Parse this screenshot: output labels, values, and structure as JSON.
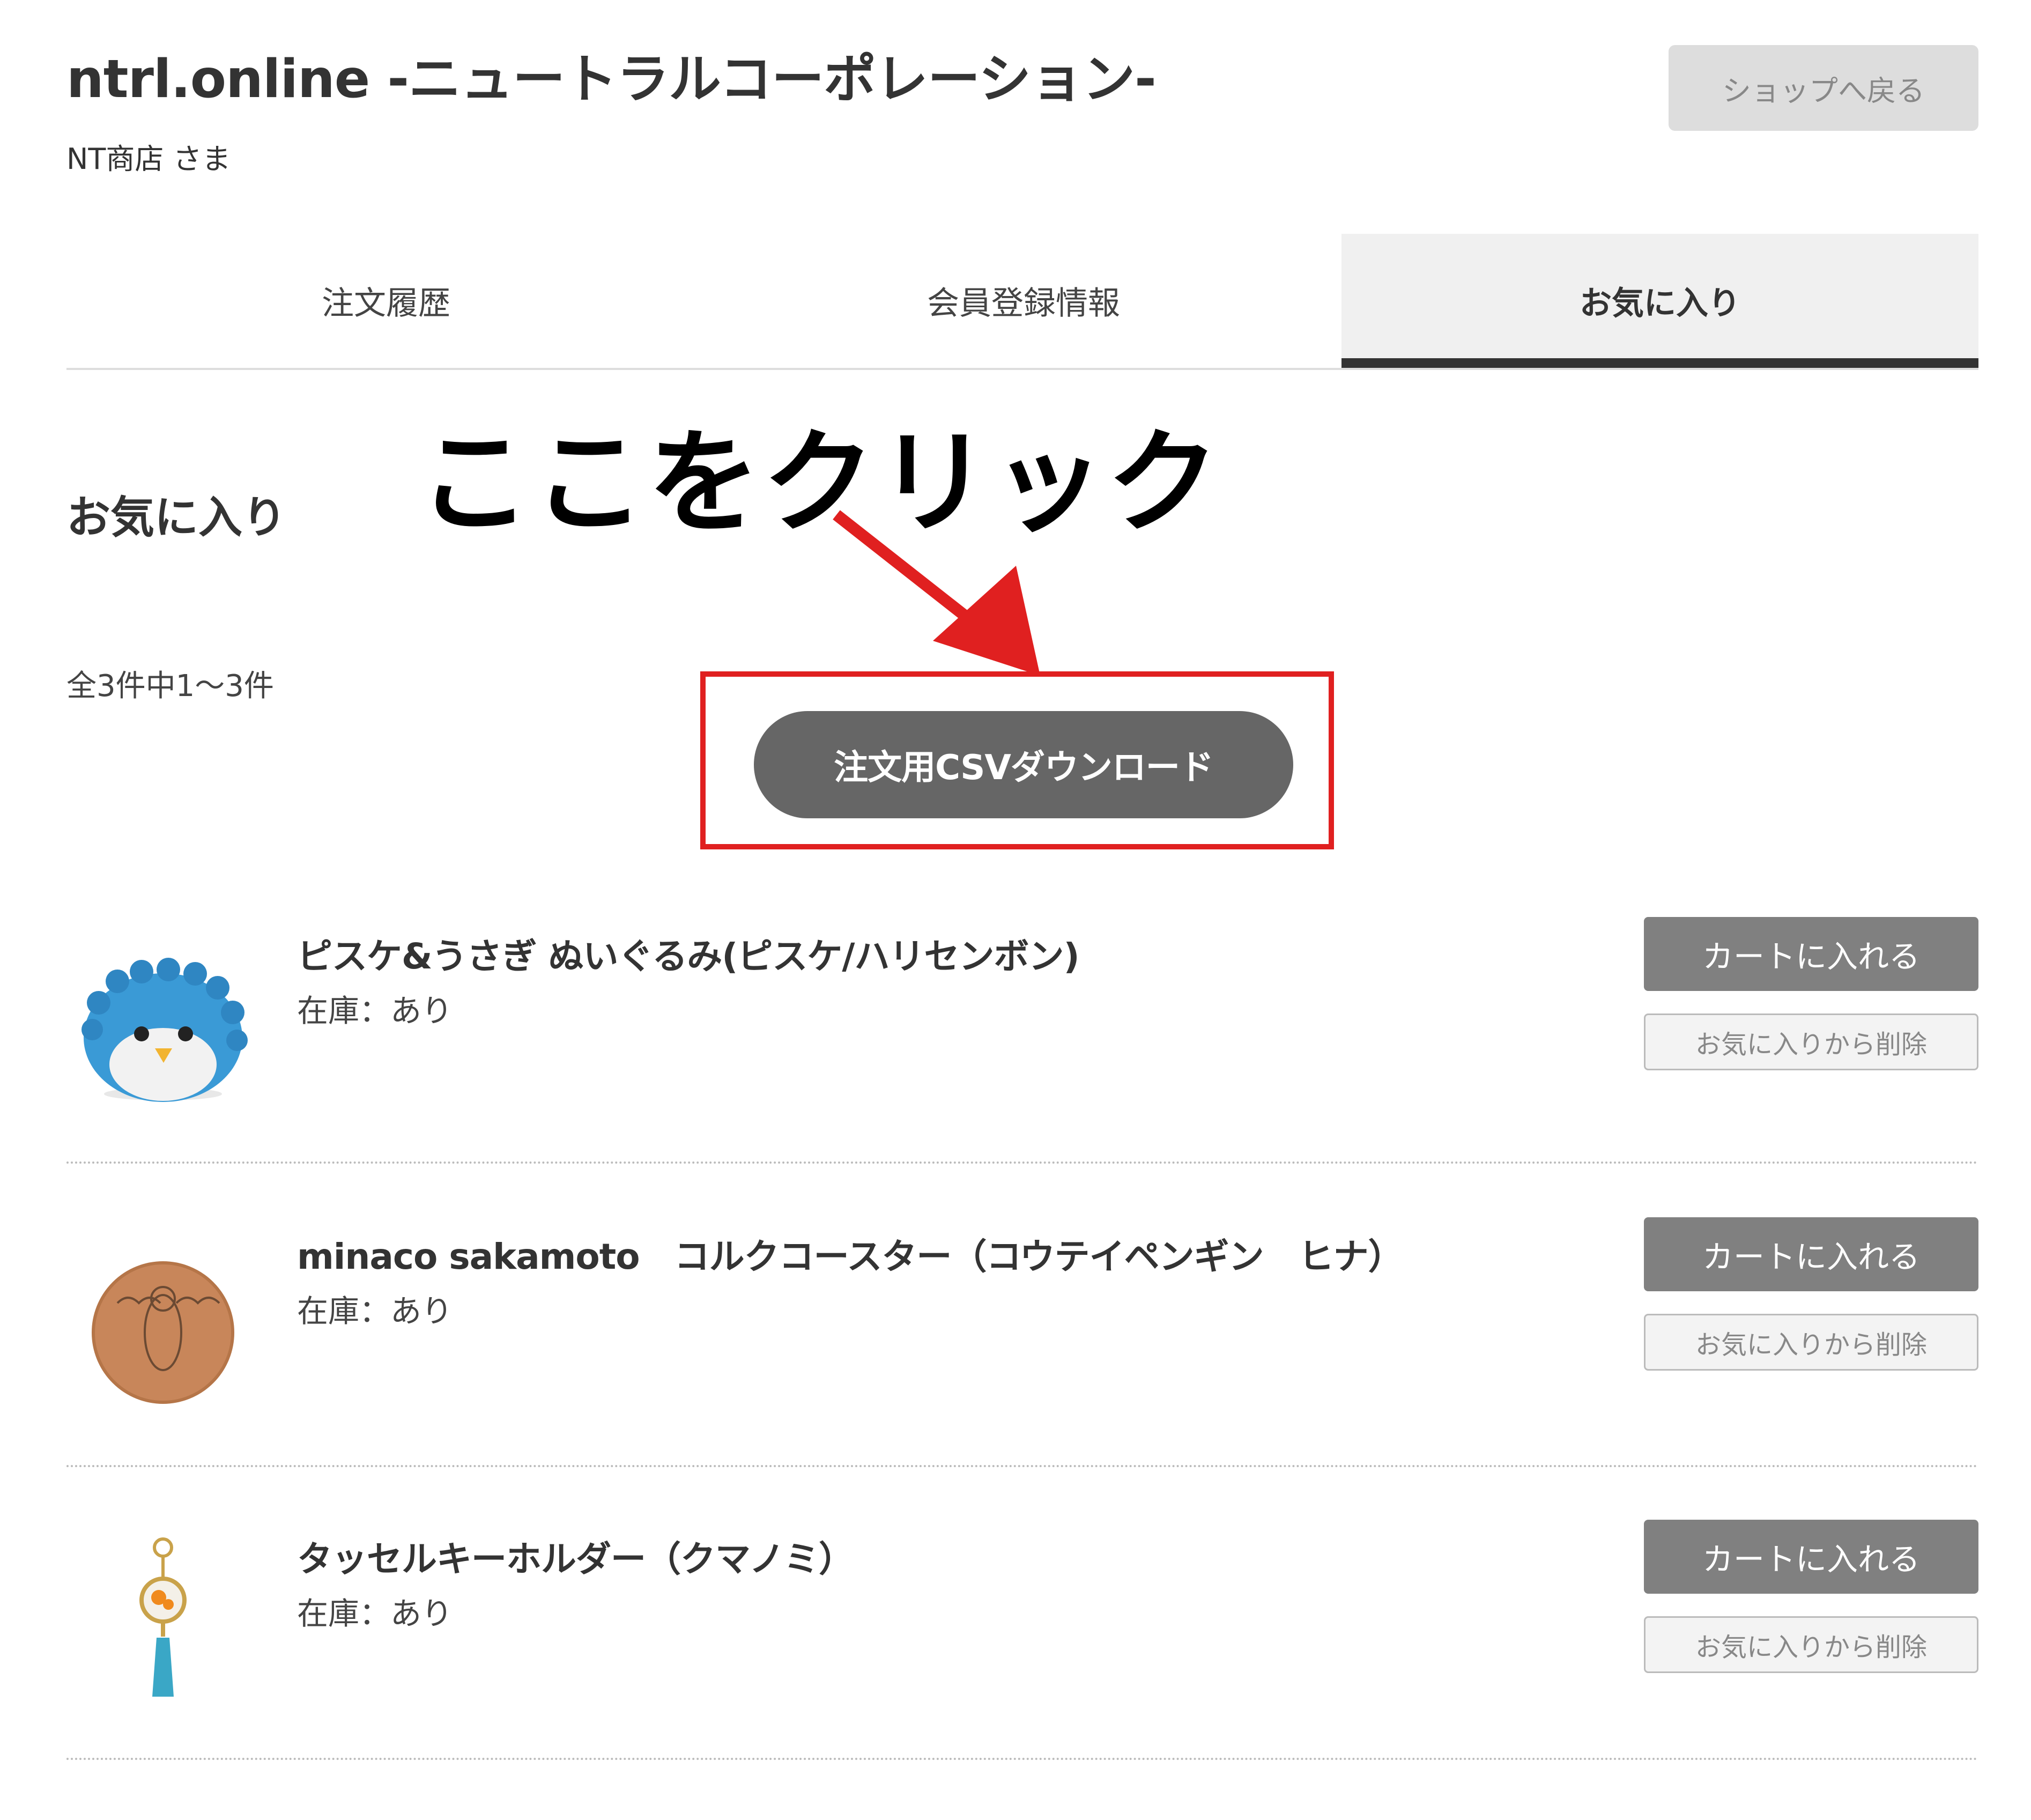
{
  "header": {
    "site_title": "ntrl.online -ニュートラルコーポレーション-",
    "account_name": "NT商店 さま",
    "back_button_label": "ショップへ戻る"
  },
  "tabs": [
    {
      "label": "注文履歴",
      "active": false
    },
    {
      "label": "会員登録情報",
      "active": false
    },
    {
      "label": "お気に入り",
      "active": true
    }
  ],
  "annotation": {
    "callout_text": "ここをクリック",
    "highlight_color": "#e02020",
    "arrow_icon": "arrow-down-right-icon"
  },
  "main": {
    "section_title": "お気に入り",
    "result_count": "全3件中1～3件",
    "csv_button_label": "注文用CSVダウンロード"
  },
  "items": [
    {
      "name": "ピスケ&うさぎ ぬいぐるみ(ピスケ/ハリセンボン)",
      "stock": "在庫：あり",
      "cart_label": "カートに入れる",
      "remove_label": "お気に入りから削除",
      "thumbnail_icon": "pufferfish-plush-image"
    },
    {
      "name": "minaco sakamoto　コルクコースター（コウテイペンギン　ヒナ）",
      "stock": "在庫：あり",
      "cart_label": "カートに入れる",
      "remove_label": "お気に入りから削除",
      "thumbnail_icon": "cork-coaster-image"
    },
    {
      "name": "タッセルキーホルダー（クマノミ）",
      "stock": "在庫：あり",
      "cart_label": "カートに入れる",
      "remove_label": "お気に入りから削除",
      "thumbnail_icon": "tassel-keyholder-image"
    }
  ],
  "colors": {
    "primary_button": "#666666",
    "cart_button": "#808080",
    "active_tab_bar": "#333333"
  }
}
